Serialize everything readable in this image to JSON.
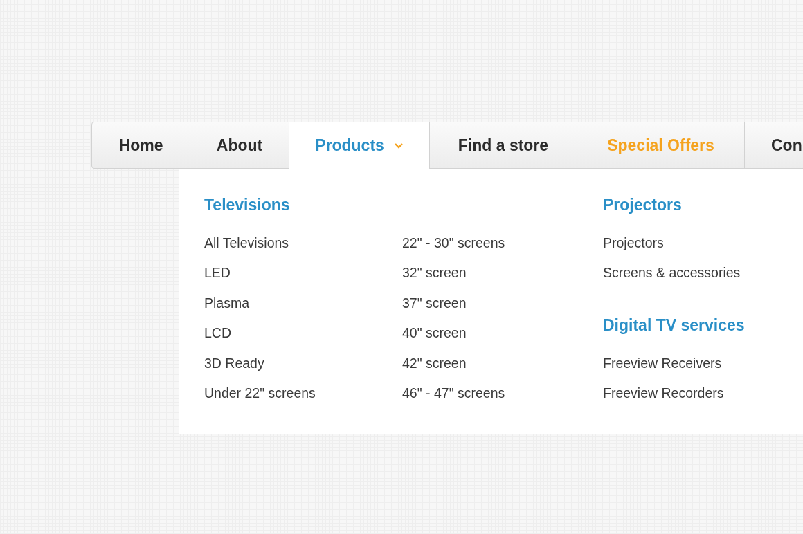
{
  "nav": {
    "tabs": [
      {
        "label": "Home",
        "selected": false,
        "kind": "normal",
        "dropdown": false
      },
      {
        "label": "About",
        "selected": false,
        "kind": "normal",
        "dropdown": false
      },
      {
        "label": "Products",
        "selected": true,
        "kind": "normal",
        "dropdown": true
      },
      {
        "label": "Find a store",
        "selected": false,
        "kind": "normal",
        "dropdown": false
      },
      {
        "label": "Special Offers",
        "selected": false,
        "kind": "offer",
        "dropdown": false
      },
      {
        "label": "Con",
        "selected": false,
        "kind": "normal",
        "dropdown": false
      }
    ]
  },
  "dropdown": {
    "columns": [
      {
        "sections": [
          {
            "heading": "Televisions",
            "items": [
              "All Televisions",
              "LED",
              "Plasma",
              "LCD",
              "3D Ready",
              "Under 22\" screens"
            ]
          }
        ]
      },
      {
        "sections": [
          {
            "items": [
              "22\" - 30\" screens",
              "32\" screen",
              "37\" screen",
              "40\" screen",
              "42\" screen",
              "46\" - 47\" screens"
            ]
          }
        ]
      },
      {
        "sections": [
          {
            "heading": "Projectors",
            "items": [
              "Projectors",
              "Screens & accessories"
            ]
          },
          {
            "heading": "Digital TV services",
            "items": [
              "Freeview Receivers",
              "Freeview Recorders"
            ]
          }
        ]
      }
    ]
  }
}
